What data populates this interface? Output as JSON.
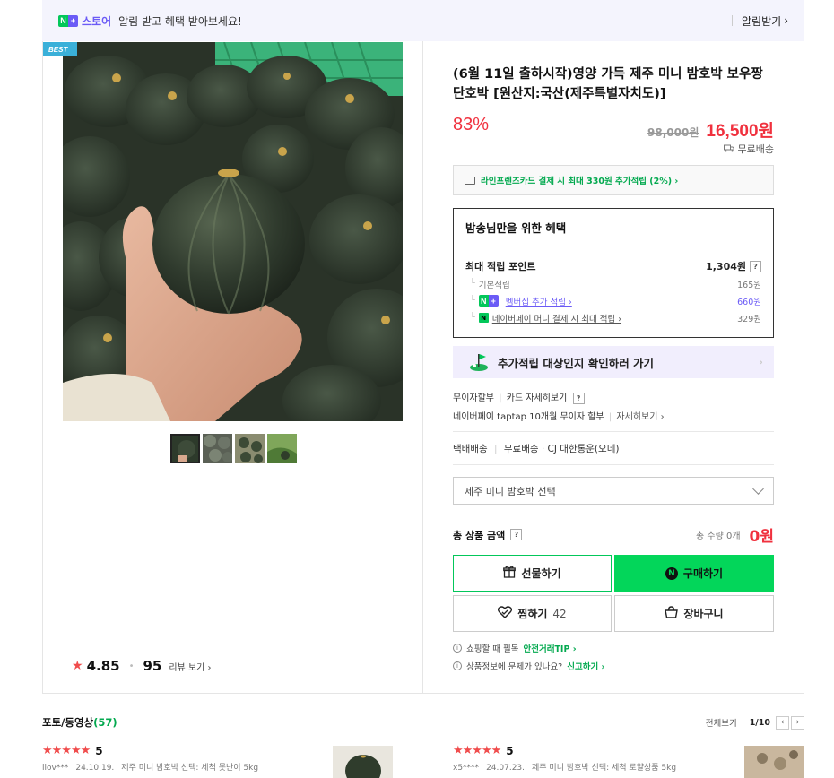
{
  "banner": {
    "store_name": "스토어",
    "message": "알림 받고 혜택 받아보세요!",
    "subscribe_label": "알림받기"
  },
  "product": {
    "badge": "BEST",
    "title": "(6월 11일 출하시작)영양 가득 제주 미니 밤호박 보우짱 단호박 [원산지:국산(제주특별자치도)]",
    "discount": "83%",
    "original_price": "98,000원",
    "sale_price": "16,500원",
    "shipping": "무료배송"
  },
  "card_benefit": "라인프렌즈카드 결제 시 최대 330원 추가적립 (2%) ›",
  "benefit": {
    "title": "밤송님만을 위한 혜택",
    "max_label": "최대 적립 포인트",
    "max_value": "1,304원",
    "rows": [
      {
        "label": "기본적립",
        "value": "165원"
      },
      {
        "label": "멤버십 추가 적립 ›",
        "value": "660원"
      },
      {
        "label": "네이버페이 머니 결제 시 최대 적립 ›",
        "value": "329원"
      }
    ]
  },
  "check_banner": "추가적립 대상인지 확인하러 가기",
  "pay_info": {
    "line1_a": "무이자할부",
    "line1_b": "카드 자세히보기",
    "line2_a": "네이버페이 taptap 10개월 무이자 할부",
    "line2_b": "자세히보기 ›"
  },
  "delivery": {
    "type": "택배배송",
    "detail": "무료배송 · CJ 대한통운(오네)"
  },
  "option_select": "제주 미니 밤호박 선택",
  "total": {
    "label": "총 상품 금액",
    "qty": "총 수량 0개",
    "sum": "0원"
  },
  "buttons": {
    "gift": "선물하기",
    "buy": "구매하기",
    "wish": "찜하기",
    "wish_count": "42",
    "cart": "장바구니"
  },
  "notices": {
    "n1_text": "쇼핑할 때 필독",
    "n1_link": "안전거래TIP ›",
    "n2_text": "상품정보에 문제가 있나요?",
    "n2_link": "신고하기 ›"
  },
  "rating": {
    "score": "4.85",
    "count": "95",
    "review_link": "리뷰 보기 ›"
  },
  "photo_reviews": {
    "title": "포토/동영상",
    "count": "(57)",
    "view_all": "전체보기",
    "page": "1/10",
    "items": [
      {
        "stars": "★★★★★",
        "score": "5",
        "user": "ilov***",
        "date": "24.10.19.",
        "option": "제주 미니 밤호박 선택: 세척 못난이 5kg"
      },
      {
        "stars": "★★★★★",
        "score": "5",
        "user": "x5****",
        "date": "24.07.23.",
        "option": "제주 미니 밤호박 선택: 세척 로얄상품 5kg"
      }
    ]
  },
  "colors": {
    "accent_green": "#03c75a",
    "price_red": "#f0313e",
    "membership_purple": "#6b5bf6"
  }
}
